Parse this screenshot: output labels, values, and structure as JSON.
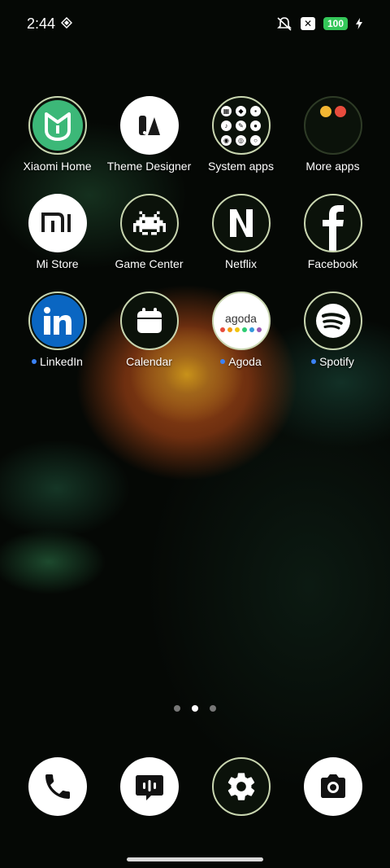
{
  "status_bar": {
    "time": "2:44",
    "battery": "100",
    "icons": [
      "diamond-icon",
      "silent-icon",
      "close-box-icon",
      "charging-icon"
    ]
  },
  "apps": [
    {
      "label": "Xiaomi Home",
      "icon": "xiaomi-home-icon",
      "dot": false
    },
    {
      "label": "Theme Designer",
      "icon": "theme-designer-icon",
      "dot": false
    },
    {
      "label": "System apps",
      "icon": "system-apps-folder-icon",
      "dot": false
    },
    {
      "label": "More apps",
      "icon": "more-apps-folder-icon",
      "dot": false
    },
    {
      "label": "Mi Store",
      "icon": "mi-store-icon",
      "dot": false
    },
    {
      "label": "Game Center",
      "icon": "game-center-icon",
      "dot": false
    },
    {
      "label": "Netflix",
      "icon": "netflix-icon",
      "dot": false
    },
    {
      "label": "Facebook",
      "icon": "facebook-icon",
      "dot": false
    },
    {
      "label": "LinkedIn",
      "icon": "linkedin-icon",
      "dot": true
    },
    {
      "label": "Calendar",
      "icon": "calendar-icon",
      "dot": false
    },
    {
      "label": "Agoda",
      "icon": "agoda-icon",
      "dot": true
    },
    {
      "label": "Spotify",
      "icon": "spotify-icon",
      "dot": true
    }
  ],
  "agoda_logo": "agoda",
  "page_indicator": {
    "total": 3,
    "active": 2
  },
  "dock": [
    "phone-icon",
    "messages-icon",
    "settings-icon",
    "camera-icon"
  ],
  "colors": {
    "accent_blue": "#3b82f6",
    "battery": "#34c759",
    "xiaomi_green": "#3cb878",
    "linkedin": "#0a66c2"
  }
}
